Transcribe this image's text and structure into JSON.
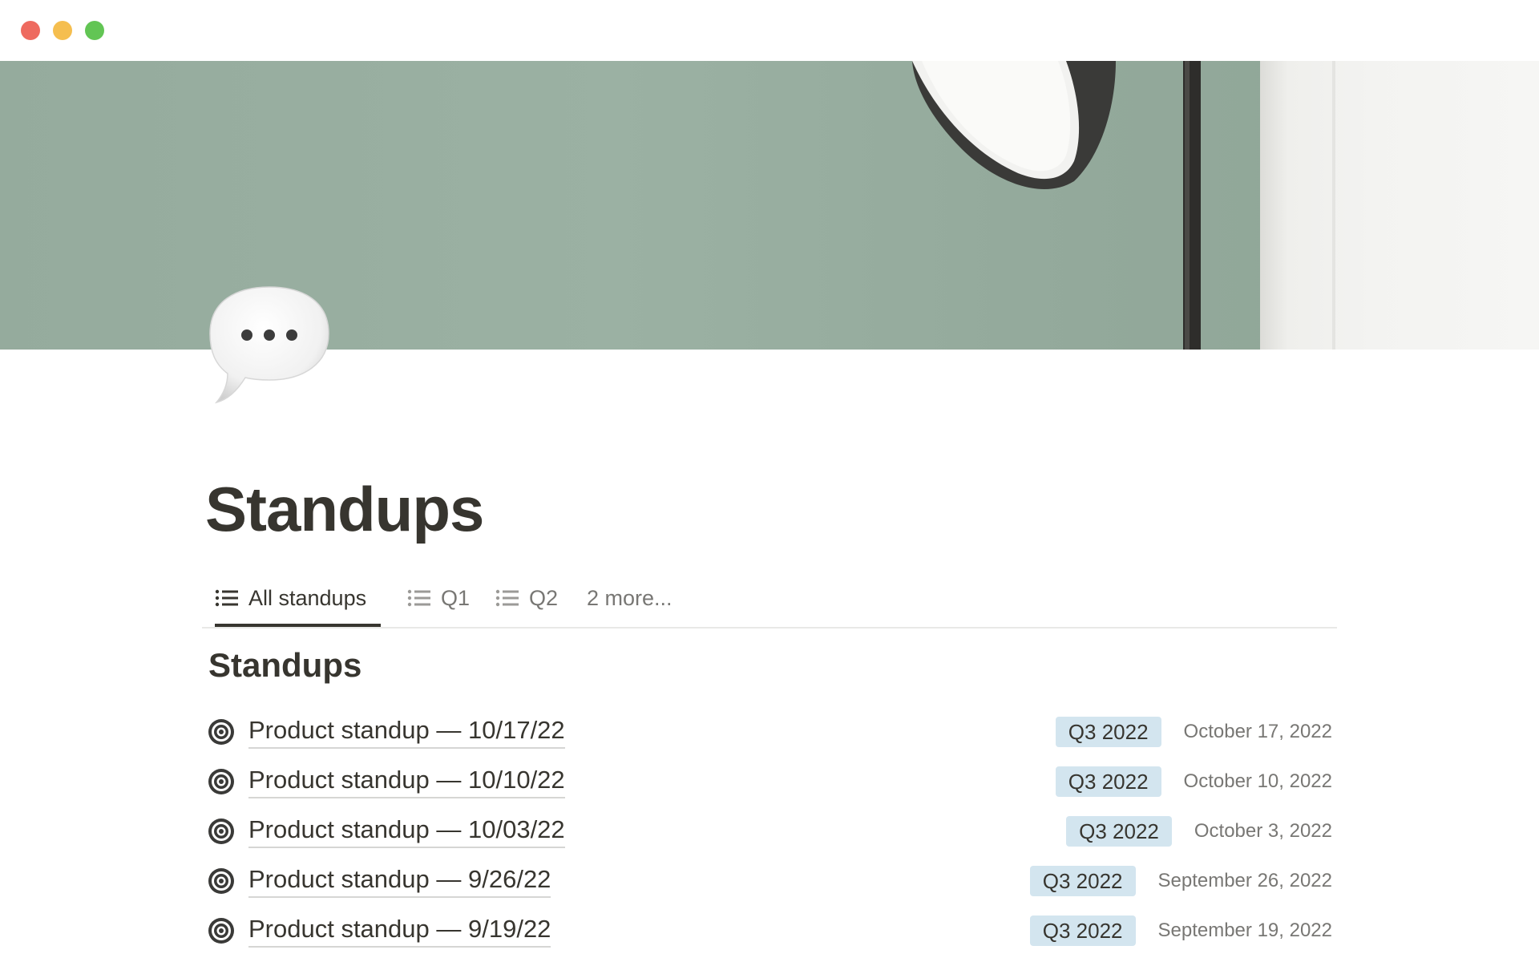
{
  "window": {
    "controls": [
      "close",
      "minimize",
      "maximize"
    ]
  },
  "cover": {
    "description_colors": {
      "wall": "#9bb1a3",
      "right_wall": "#f3f3f1",
      "lamp_shade_outer": "#3a3a38",
      "lamp_shade_inner": "#f2f2f0",
      "lamp_pole": "#2e2d2b"
    }
  },
  "page": {
    "icon": "speech-bubble-icon",
    "title": "Standups"
  },
  "tabs": [
    {
      "label": "All standups",
      "icon": "list-icon",
      "active": true
    },
    {
      "label": "Q1",
      "icon": "list-icon",
      "active": false
    },
    {
      "label": "Q2",
      "icon": "list-icon",
      "active": false
    },
    {
      "label": "2 more...",
      "active": false
    }
  ],
  "section": {
    "heading": "Standups"
  },
  "rows": [
    {
      "title": "Product standup — 10/17/22",
      "quarter": "Q3 2022",
      "date": "October 17, 2022",
      "icon": "target-icon"
    },
    {
      "title": "Product standup — 10/10/22",
      "quarter": "Q3 2022",
      "date": "October 10, 2022",
      "icon": "target-icon"
    },
    {
      "title": "Product standup — 10/03/22",
      "quarter": "Q3 2022",
      "date": "October 3, 2022",
      "icon": "target-icon"
    },
    {
      "title": "Product standup — 9/26/22",
      "quarter": "Q3 2022",
      "date": "September 26, 2022",
      "icon": "target-icon"
    },
    {
      "title": "Product standup — 9/19/22",
      "quarter": "Q3 2022",
      "date": "September 19, 2022",
      "icon": "target-icon"
    }
  ],
  "colors": {
    "text": "#37352f",
    "muted": "#787774",
    "badge_bg": "#d3e5ef",
    "divider": "#e9e9e7"
  }
}
